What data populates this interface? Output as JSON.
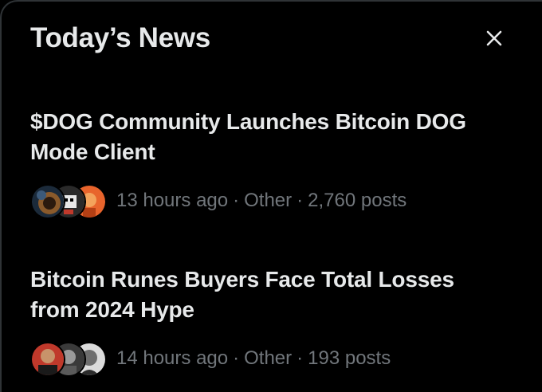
{
  "panel": {
    "title": "Today’s News",
    "close_icon": "close-icon"
  },
  "stories": [
    {
      "headline_line1": "$DOG Community Launches Bitcoin DOG",
      "headline_line2": "Mode Client",
      "time": "13 hours ago",
      "category": "Other",
      "posts": "2,760 posts",
      "separator": "·"
    },
    {
      "headline_line1": "Bitcoin Runes Buyers Face Total Losses",
      "headline_line2": "from 2024 Hype",
      "time": "14 hours ago",
      "category": "Other",
      "posts": "193 posts",
      "separator": "·"
    }
  ],
  "colors": {
    "background": "#000000",
    "text_primary": "#e7e9ea",
    "text_secondary": "#71767b",
    "border": "#2f3336"
  }
}
